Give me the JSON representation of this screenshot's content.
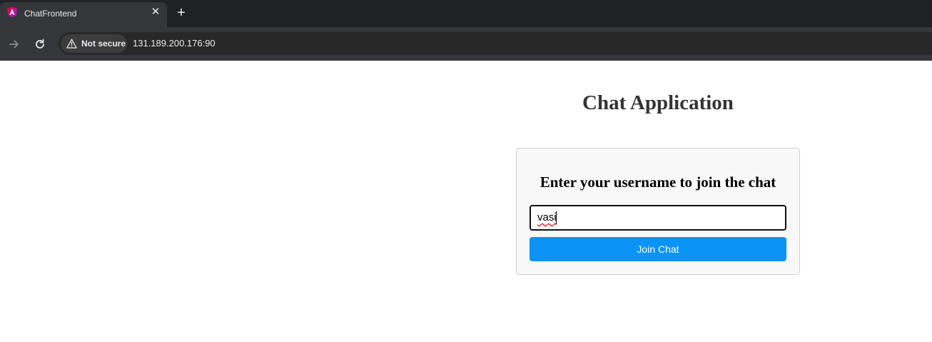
{
  "browser": {
    "tab": {
      "title": "ChatFrontend",
      "close_glyph": "✕",
      "favicon": "angular-logo-icon"
    },
    "new_tab_glyph": "+",
    "address_bar": {
      "security_label": "Not secure",
      "url": "131.189.200.176:90"
    },
    "icons": {
      "back": "arrow-right-icon",
      "reload": "reload-icon",
      "warning": "warning-icon"
    }
  },
  "page": {
    "title": "Chat Application",
    "card": {
      "heading": "Enter your username to join the chat",
      "username_value": "vasi",
      "join_button_label": "Join Chat"
    }
  },
  "colors": {
    "join_button": "#0b93f6",
    "card_background": "#f8f8f8",
    "chrome_dark": "#202124"
  }
}
